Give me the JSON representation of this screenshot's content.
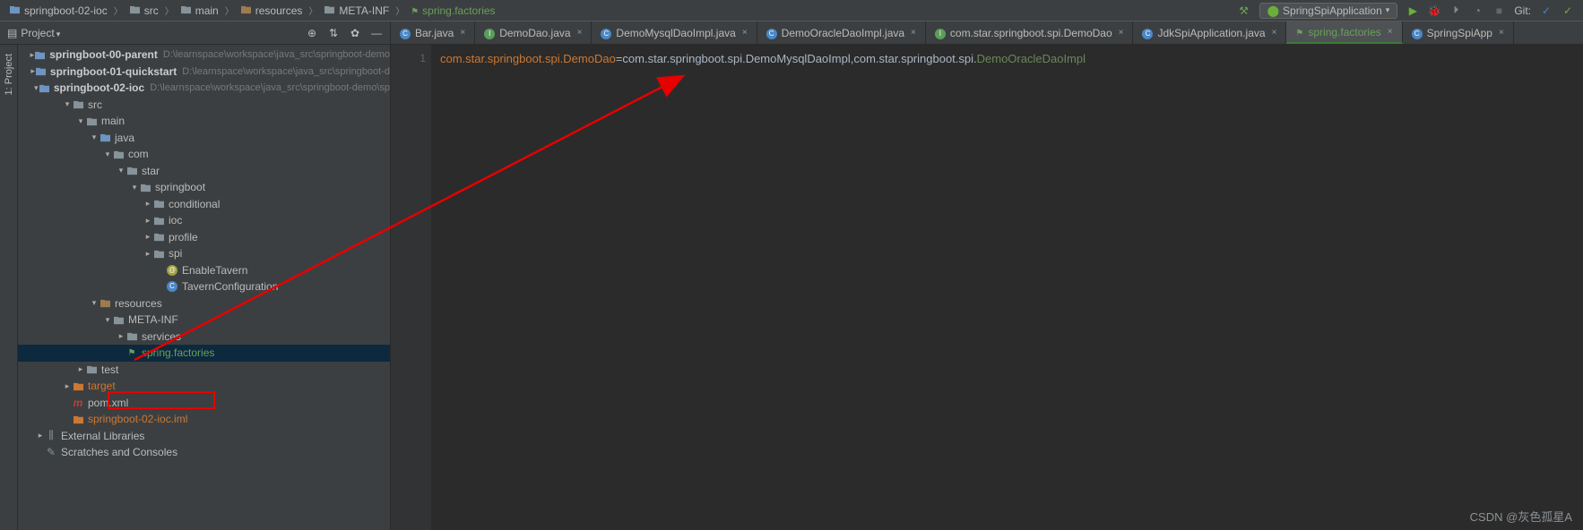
{
  "breadcrumb": [
    {
      "icon": "module",
      "text": "springboot-02-ioc"
    },
    {
      "icon": "folder",
      "text": "src"
    },
    {
      "icon": "folder",
      "text": "main"
    },
    {
      "icon": "resources",
      "text": "resources"
    },
    {
      "icon": "folder",
      "text": "META-INF"
    },
    {
      "icon": "factories",
      "text": "spring.factories",
      "cls": "green"
    }
  ],
  "run_config": "SpringSpiApplication",
  "git_label": "Git:",
  "project_label": "Project",
  "tabs": [
    {
      "icon": "java",
      "text": "Bar.java",
      "trunc": true
    },
    {
      "icon": "interface",
      "text": "DemoDao.java"
    },
    {
      "icon": "class",
      "text": "DemoMysqlDaoImpl.java"
    },
    {
      "icon": "class",
      "text": "DemoOracleDaoImpl.java"
    },
    {
      "icon": "interface",
      "text": "com.star.springboot.spi.DemoDao"
    },
    {
      "icon": "class",
      "text": "JdkSpiApplication.java"
    },
    {
      "icon": "factories",
      "text": "spring.factories",
      "active": true,
      "green": true
    },
    {
      "icon": "class",
      "text": "SpringSpiApp",
      "trunc": true
    }
  ],
  "tree": [
    {
      "d": 0,
      "a": "r",
      "i": "module",
      "t": "springboot-00-parent",
      "b": true,
      "p": "D:\\learnspace\\workspace\\java_src\\springboot-demo"
    },
    {
      "d": 0,
      "a": "r",
      "i": "module",
      "t": "springboot-01-quickstart",
      "b": true,
      "p": "D:\\learnspace\\workspace\\java_src\\springboot-d"
    },
    {
      "d": 0,
      "a": "d",
      "i": "module",
      "t": "springboot-02-ioc",
      "b": true,
      "p": "D:\\learnspace\\workspace\\java_src\\springboot-demo\\sp"
    },
    {
      "d": 1,
      "a": "d",
      "i": "folder",
      "t": "src"
    },
    {
      "d": 2,
      "a": "d",
      "i": "folder",
      "t": "main"
    },
    {
      "d": 3,
      "a": "d",
      "i": "folder-blue",
      "t": "java"
    },
    {
      "d": 4,
      "a": "d",
      "i": "pkg",
      "t": "com"
    },
    {
      "d": 5,
      "a": "d",
      "i": "pkg",
      "t": "star"
    },
    {
      "d": 6,
      "a": "d",
      "i": "pkg",
      "t": "springboot"
    },
    {
      "d": 7,
      "a": "r",
      "i": "pkg",
      "t": "conditional"
    },
    {
      "d": 7,
      "a": "r",
      "i": "pkg",
      "t": "ioc"
    },
    {
      "d": 7,
      "a": "r",
      "i": "pkg",
      "t": "profile"
    },
    {
      "d": 7,
      "a": "r",
      "i": "pkg",
      "t": "spi"
    },
    {
      "d": 8,
      "a": "",
      "i": "anno",
      "t": "EnableTavern"
    },
    {
      "d": 8,
      "a": "",
      "i": "class",
      "t": "TavernConfiguration"
    },
    {
      "d": 3,
      "a": "d",
      "i": "resources",
      "t": "resources"
    },
    {
      "d": 4,
      "a": "d",
      "i": "folder",
      "t": "META-INF"
    },
    {
      "d": 5,
      "a": "r",
      "i": "folder",
      "t": "services"
    },
    {
      "d": 5,
      "a": "",
      "i": "factories",
      "t": "spring.factories",
      "sel": true,
      "greenf": true
    },
    {
      "d": 2,
      "a": "r",
      "i": "folder",
      "t": "test"
    },
    {
      "d": 1,
      "a": "r",
      "i": "folder-orange",
      "t": "target",
      "orange": true
    },
    {
      "d": 1,
      "a": "",
      "i": "maven",
      "t": "pom.xml"
    },
    {
      "d": 1,
      "a": "",
      "i": "iml",
      "t": "springboot-02-ioc.iml",
      "orange": true
    },
    {
      "d": -1,
      "a": "r",
      "i": "lib",
      "t": "External Libraries"
    },
    {
      "d": -1,
      "a": "",
      "i": "scratch",
      "t": "Scratches and Consoles"
    }
  ],
  "gutter_line": "1",
  "code": {
    "key": "com.star.springboot.spi.DemoDao",
    "eq": "=",
    "val1": "com.star.springboot.spi.DemoMysqlDaoImpl,com.star.springboot.spi.",
    "val2": "DemoOracleDaoImpl"
  },
  "watermark": "CSDN @灰色孤星A"
}
